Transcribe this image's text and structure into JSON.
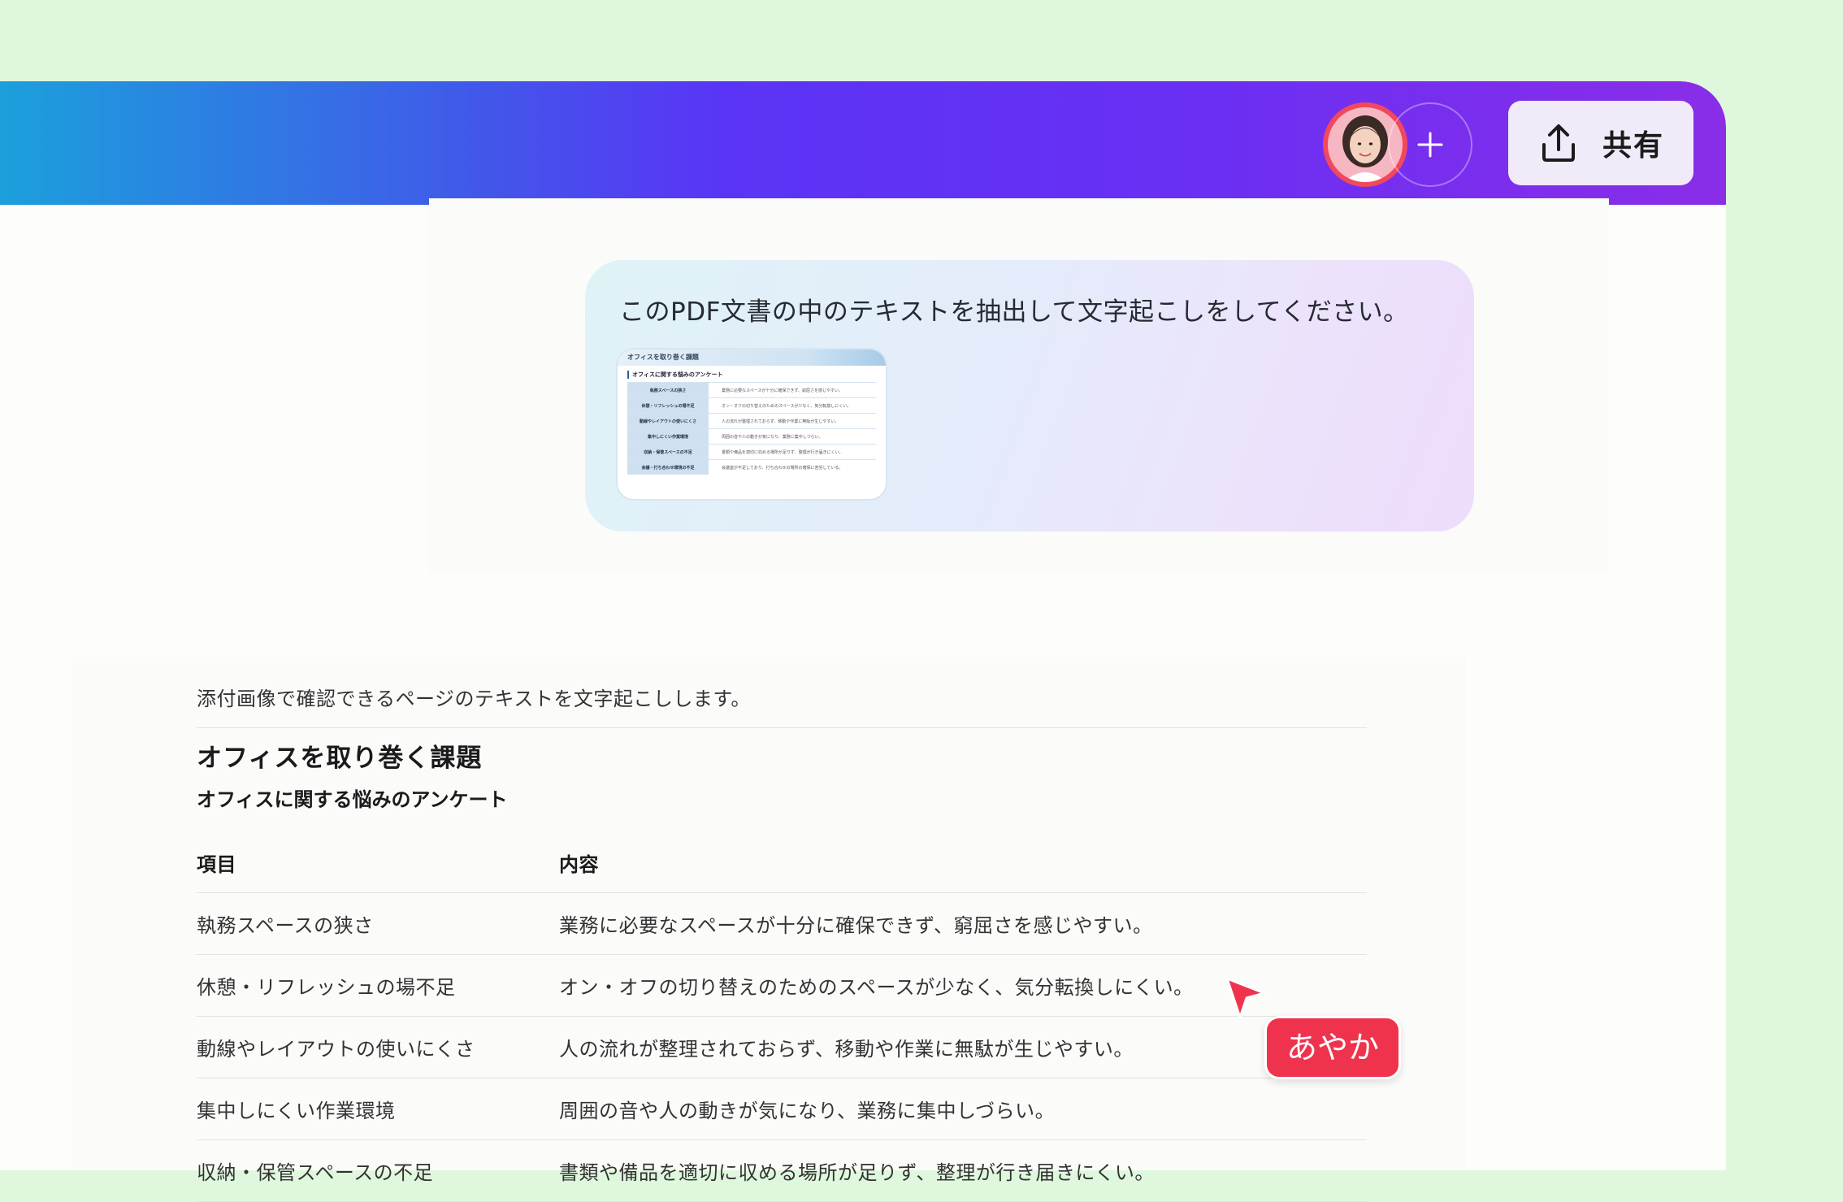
{
  "header": {
    "share_label": "共有",
    "add_user_icon": "plus-icon",
    "share_icon": "upload-icon",
    "gradient": [
      "#1ba0dc",
      "#5a34f6",
      "#8a2ee8"
    ]
  },
  "user_message": {
    "prompt": "このPDF文書の中のテキストを抽出して文字起こしをしてください。",
    "attachment": {
      "title": "オフィスを取り巻く課題",
      "subtitle": "オフィスに関する悩みのアンケート",
      "rows": [
        {
          "item": "執務スペースの狭さ",
          "content": "業務に必要なスペースが十分に確保できず、窮屈さを感じやすい。"
        },
        {
          "item": "休憩・リフレッシュの場不足",
          "content": "オン・オフの切り替えのためのスペースが少なく、気分転換しにくい。"
        },
        {
          "item": "動線やレイアウトの使いにくさ",
          "content": "人の流れが整理されておらず、移動や作業に無駄が生じやすい。"
        },
        {
          "item": "集中しにくい作業環境",
          "content": "周囲の音や人の動きが気になり、業務に集中しづらい。"
        },
        {
          "item": "収納・保管スペースの不足",
          "content": "書類や備品を適切に収める場所が足りず、整理が行き届きにくい。"
        },
        {
          "item": "会議・打ち合わせ環境の不足",
          "content": "会議室が不足しており、打ち合わせの場所の確保に苦労している。"
        }
      ]
    }
  },
  "answer": {
    "intro": "添付画像で確認できるページのテキストを文字起こしします。",
    "heading": "オフィスを取り巻く課題",
    "subheading": "オフィスに関する悩みのアンケート",
    "table": {
      "headers": [
        "項目",
        "内容"
      ],
      "rows": [
        [
          "執務スペースの狭さ",
          "業務に必要なスペースが十分に確保できず、窮屈さを感じやすい。"
        ],
        [
          "休憩・リフレッシュの場不足",
          "オン・オフの切り替えのためのスペースが少なく、気分転換しにくい。"
        ],
        [
          "動線やレイアウトの使いにくさ",
          "人の流れが整理されておらず、移動や作業に無駄が生じやすい。"
        ],
        [
          "集中しにくい作業環境",
          "周囲の音や人の動きが気になり、業務に集中しづらい。"
        ],
        [
          "収納・保管スペースの不足",
          "書類や備品を適切に収める場所が足りず、整理が行き届きにくい。"
        ]
      ]
    }
  },
  "collaborator": {
    "name": "あやか",
    "color": "#f0334d"
  }
}
